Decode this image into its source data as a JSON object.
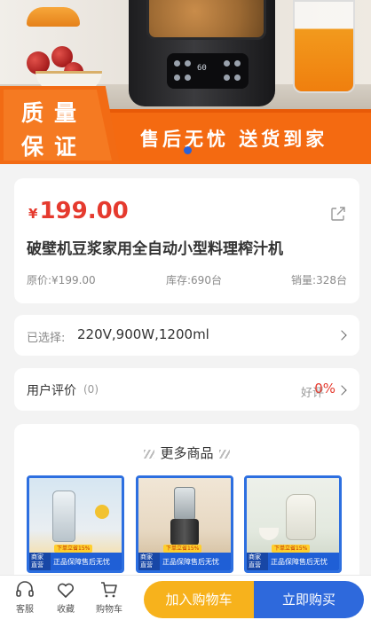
{
  "banner": {
    "badge_line1": "质量",
    "badge_line2": "保证",
    "strip_text": "售后无忧 送货到家",
    "accent_color": "#f46a11",
    "panel_text": "60"
  },
  "product": {
    "currency": "¥",
    "price": "199.00",
    "title": "破壁机豆浆家用全自动小型料理榨汁机",
    "original_price": "原价:¥199.00",
    "stock": "库存:690台",
    "sales": "销量:328台",
    "price_color": "#e53a2e"
  },
  "selection": {
    "label": "已选择:",
    "value": "220V,900W,1200ml"
  },
  "reviews": {
    "label": "用户评价",
    "count": "(0)",
    "good_label": "好评",
    "good_value": "0%"
  },
  "more": {
    "title": "更多商品",
    "items": [
      {
        "tag": "商家直营",
        "band": "正品保障售后无忧",
        "ribbon": "下单立省15%"
      },
      {
        "tag": "商家直营",
        "band": "正品保障售后无忧",
        "ribbon": "下单立省15%"
      },
      {
        "tag": "商家直营",
        "band": "正品保障售后无忧",
        "ribbon": "下单立省15%"
      }
    ]
  },
  "bottom_bar": {
    "service": "客服",
    "favorite": "收藏",
    "cart": "购物车",
    "add_to_cart": "加入购物车",
    "buy_now": "立即购买",
    "cart_color": "#f7b21c",
    "buy_color": "#2e69dc"
  }
}
